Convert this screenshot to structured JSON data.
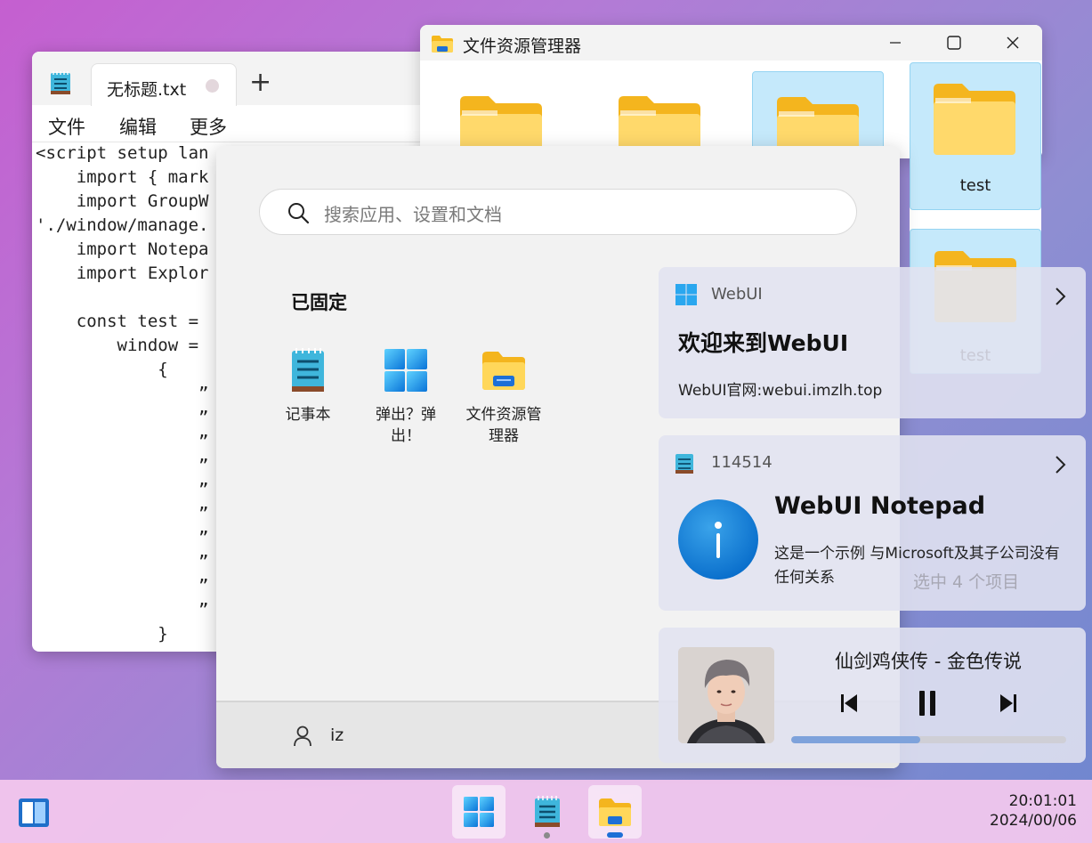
{
  "notepad": {
    "tab_title": "无标题.txt",
    "new_tab_label": "+",
    "menu": [
      "文件",
      "编辑",
      "更多"
    ],
    "code_lines": [
      "<script setup lan",
      "    import { mark",
      "    import GroupW",
      "'./window/manage.",
      "    import Notepa",
      "    import Explor",
      "",
      "    const test =",
      "        window =",
      "            {",
      "                ”",
      "                ”",
      "                ”",
      "                ”",
      "                ”",
      "                ”",
      "                ”",
      "                ”",
      "                ”",
      "                ”",
      "            }"
    ]
  },
  "explorer": {
    "title": "文件资源管理器",
    "folders": [
      {
        "label": "",
        "selected": false
      },
      {
        "label": "",
        "selected": false
      },
      {
        "label": "",
        "selected": true
      },
      {
        "label": "test",
        "selected": true
      },
      {
        "label": "test",
        "selected": true
      }
    ]
  },
  "start": {
    "search_placeholder": "搜索应用、设置和文档",
    "pinned_title": "已固定",
    "pinned": [
      {
        "label": "记事本",
        "icon": "notepad-icon"
      },
      {
        "label": "弹出？弹出！",
        "icon": "windows-logo-icon"
      },
      {
        "label": "文件资源管理器",
        "icon": "file-explorer-icon"
      }
    ],
    "user_name": "iz"
  },
  "notifications": [
    {
      "app": "WebUI",
      "title": "欢迎来到WebUI",
      "body": "WebUI官网:webui.imzlh.top"
    },
    {
      "app": "114514",
      "title": "WebUI Notepad",
      "body": "这是一个示例 与Microsoft及其子公司没有任何关系"
    }
  ],
  "explorer_status_ghost": "选中 4 个项目",
  "player": {
    "song": "仙剑鸡侠传 - 金色传说",
    "progress": 0.47
  },
  "taskbar": {
    "time": "20:01:01",
    "date": "2024/00/06"
  },
  "colors": {
    "accent": "#0a6fcc",
    "selection": "#c5e9fb",
    "folder": "#f7c948"
  }
}
